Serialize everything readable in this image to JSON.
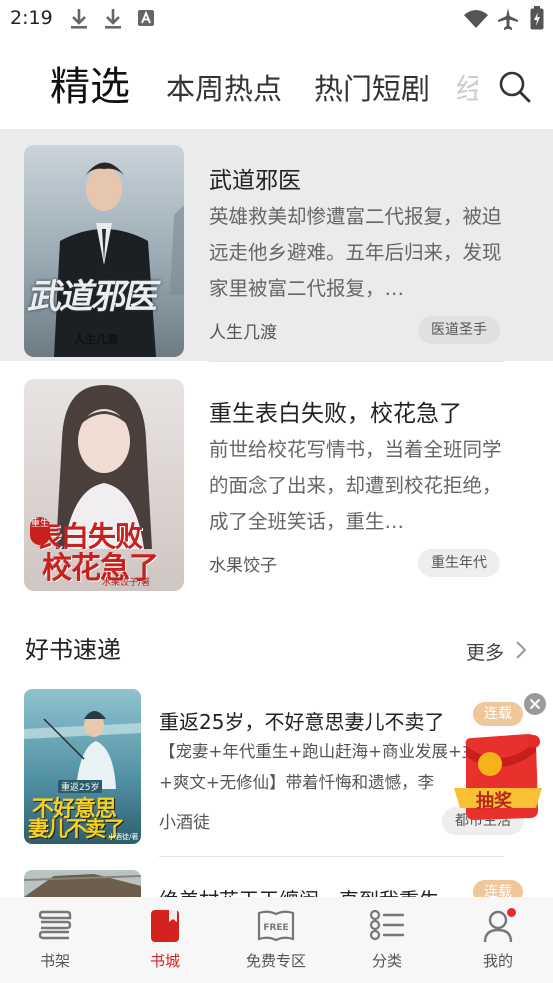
{
  "status_bar": {
    "time": "2:19",
    "left_icons": [
      "download-icon",
      "download-icon",
      "text-a-icon"
    ],
    "right_icons": [
      "wifi-icon",
      "airplane-mode-icon",
      "battery-charging-icon"
    ]
  },
  "tabs": {
    "active": "精选",
    "items": [
      "本周热点",
      "热门短剧"
    ],
    "partial": "经"
  },
  "featured": [
    {
      "title": "武道邪医",
      "desc": "英雄救美却惨遭富二代报复，被迫远走他乡避难。五年后归来，发现家里被富二代报复，…",
      "author": "人生几渡",
      "tag": "医道圣手",
      "cover_text": "武道邪医",
      "cover_author": "人生几渡"
    },
    {
      "title": "重生表白失败，校花急了",
      "desc": "前世给校花写情书，当着全班同学的面念了出来，却遭到校花拒绝，成了全班笑话，重生…",
      "author": "水果饺子",
      "tag": "重生年代",
      "cover_text_top": "表白失败",
      "cover_text_bottom": "校花急了",
      "cover_badge": "重生",
      "cover_author": "水果饺子/著"
    }
  ],
  "section": {
    "title": "好书速递",
    "more": "更多"
  },
  "express": [
    {
      "title": "重返25岁，不好意思妻儿不卖了",
      "desc": "【宠妻+年代重生+跑山赶海+商业发展+主+爽文+无修仙】带着忏悔和遗憾，李",
      "author": "小酒徒",
      "tag": "都市生活",
      "badge": "连载",
      "cover_small": "重返25岁",
      "cover_line1": "不好意思",
      "cover_line2": "妻儿不卖了",
      "cover_author": "小酒徒/著"
    },
    {
      "title": "绝美村花天天缠闹，直到我重生",
      "badge": "连载"
    }
  ],
  "floating": {
    "label": "抽奖"
  },
  "bottom_nav": [
    {
      "label": "书架",
      "icon": "bookshelf-icon",
      "active": false
    },
    {
      "label": "书城",
      "icon": "bookstore-icon",
      "active": true
    },
    {
      "label": "免费专区",
      "icon": "free-book-icon",
      "active": false,
      "icon_text": "FREE"
    },
    {
      "label": "分类",
      "icon": "category-list-icon",
      "active": false
    },
    {
      "label": "我的",
      "icon": "user-icon",
      "active": false
    }
  ],
  "colors": {
    "accent_red": "#d4221f",
    "highlight_bg": "#ebebeb",
    "serial_badge": "#efc79a",
    "nav_bg": "#f7f7f7"
  }
}
